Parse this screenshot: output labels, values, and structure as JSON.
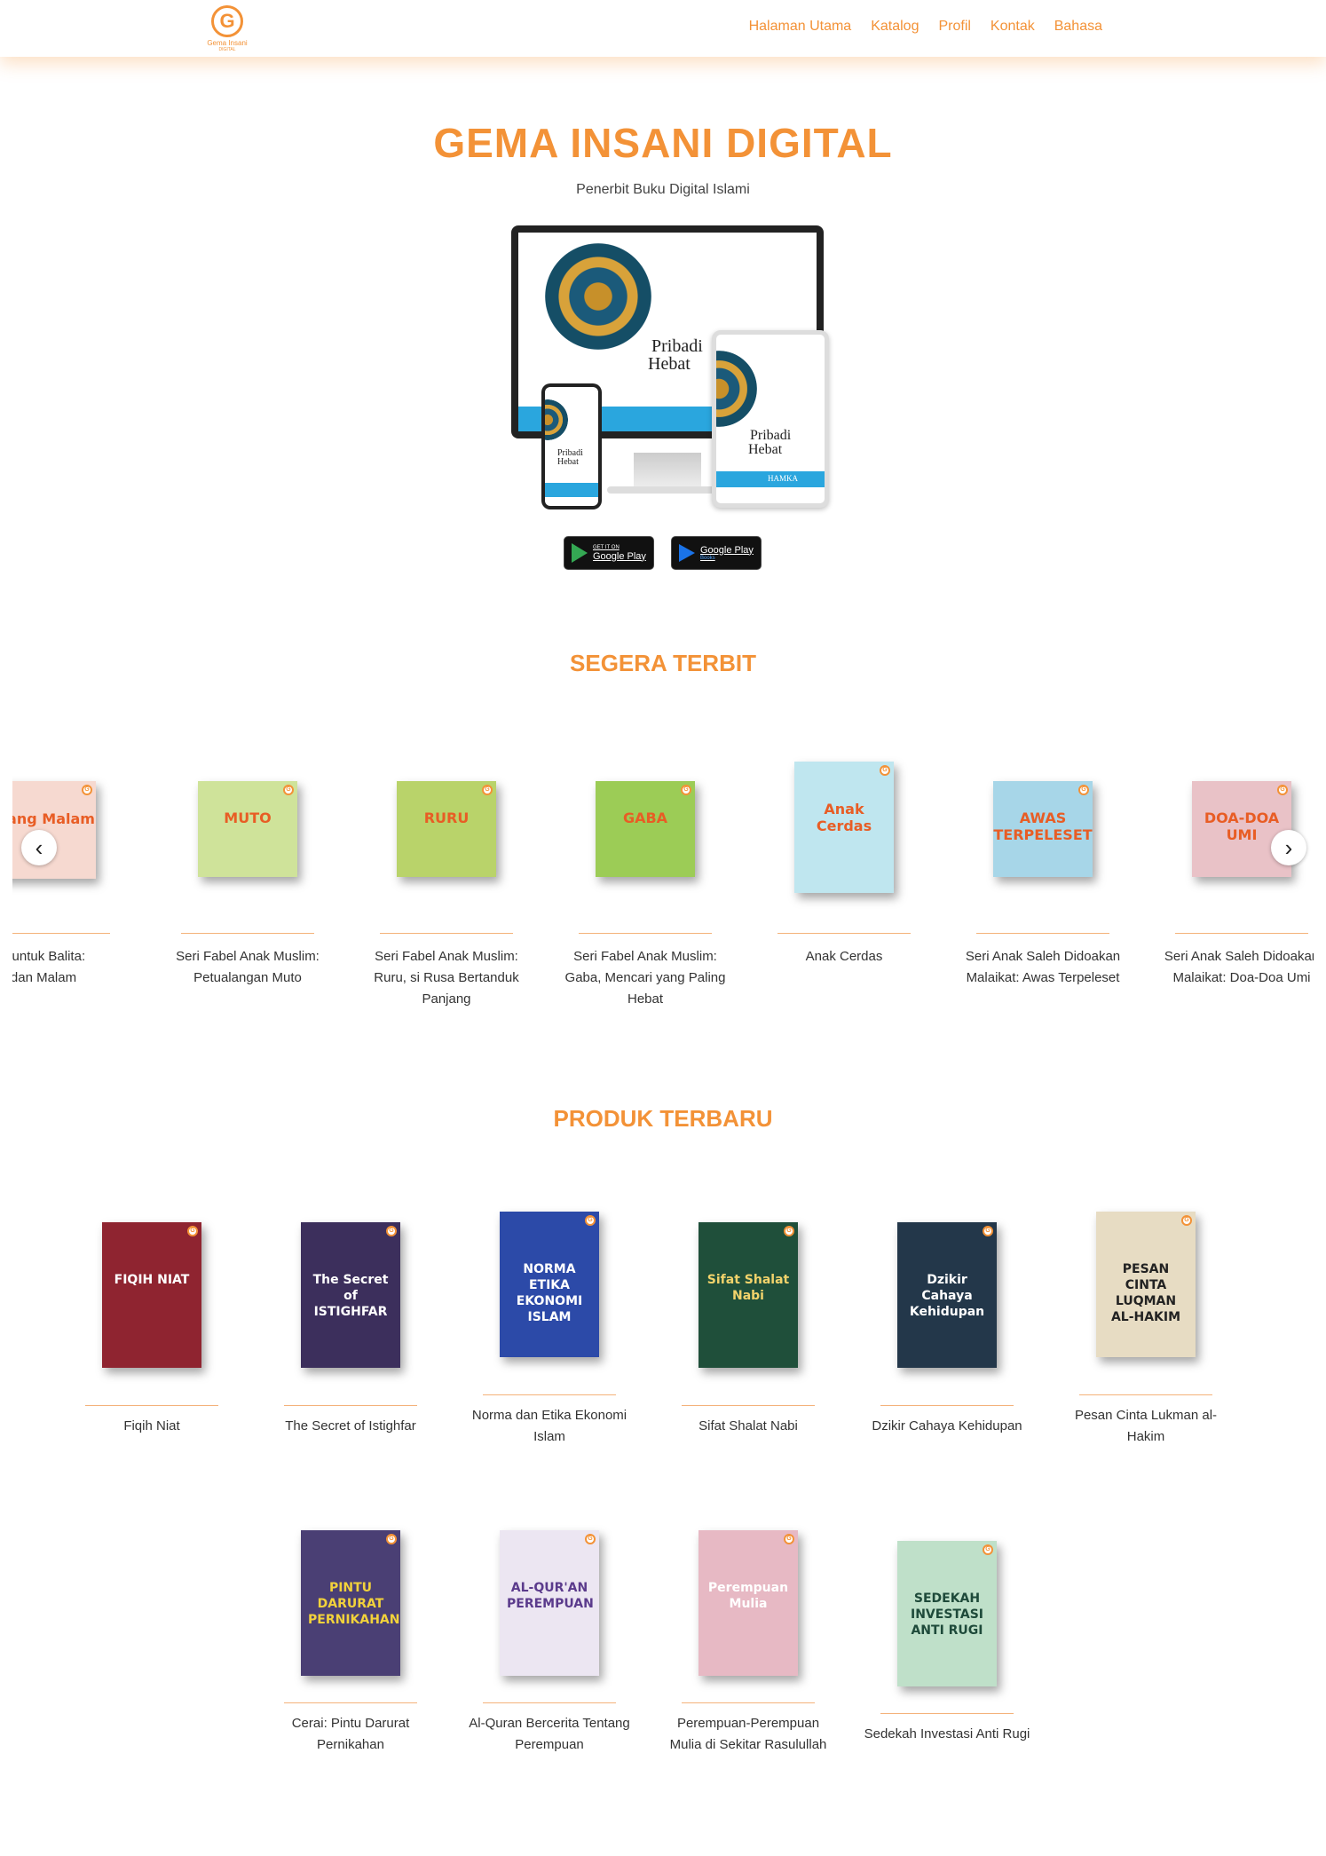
{
  "brand": {
    "logo_letter": "G",
    "logo_line1": "Gema Insani",
    "logo_line2": "DIGITAL"
  },
  "nav": [
    "Halaman Utama",
    "Katalog",
    "Profil",
    "Kontak",
    "Bahasa"
  ],
  "colors": {
    "accent": "#f39237",
    "text": "#333333"
  },
  "hero": {
    "title": "GEMA INSANI DIGITAL",
    "subtitle": "Penerbit Buku Digital Islami",
    "mockup_book_title_1": "Pribadi",
    "mockup_book_title_2": "Hebat",
    "mockup_author": "HAMKA",
    "store1_small": "GET IT ON",
    "store1_big": "Google Play",
    "store2_big": "Google Play",
    "store2_small": "Books"
  },
  "segera": {
    "title": "SEGERA TERBIT",
    "items": [
      {
        "caption": "s untuk Balita:\ndan Malam",
        "cover_text": "Siang Malam",
        "cover_color": "#f6d9d0"
      },
      {
        "caption": "Seri Fabel Anak Muslim:\nPetualangan Muto",
        "cover_text": "MUTO",
        "cover_color": "#cfe39a"
      },
      {
        "caption": "Seri Fabel Anak Muslim:\nRuru, si Rusa Bertanduk\nPanjang",
        "cover_text": "RURU",
        "cover_color": "#b9d36a"
      },
      {
        "caption": "Seri Fabel Anak Muslim:\nGaba, Mencari yang Paling\nHebat",
        "cover_text": "GABA",
        "cover_color": "#9ccc56"
      },
      {
        "caption": "Anak Cerdas",
        "cover_text": "Anak Cerdas",
        "cover_color": "#bfe6ef"
      },
      {
        "caption": "Seri Anak Saleh Didoakan\nMalaikat: Awas Terpeleset",
        "cover_text": "AWAS TERPELESET",
        "cover_color": "#a7d6e8"
      },
      {
        "caption": "Seri Anak Saleh Didoakan\nMalaikat: Doa-Doa Umi",
        "cover_text": "DOA-DOA UMI",
        "cover_color": "#e9c2c7"
      }
    ],
    "prev_arrow": "‹",
    "next_arrow": "›"
  },
  "produk": {
    "title": "PRODUK TERBARU",
    "items": [
      {
        "caption": "Fiqih Niat",
        "cover_text": "FIQIH NIAT",
        "cover_color": "#8f2430",
        "text_color": "#ffffff"
      },
      {
        "caption": "The Secret of Istighfar",
        "cover_text": "The Secret of ISTIGHFAR",
        "cover_color": "#3c2f5c",
        "text_color": "#ffffff"
      },
      {
        "caption": "Norma dan Etika Ekonomi\nIslam",
        "cover_text": "NORMA ETIKA EKONOMI ISLAM",
        "cover_color": "#2c4aa8",
        "text_color": "#ffffff"
      },
      {
        "caption": "Sifat Shalat Nabi",
        "cover_text": "Sifat Shalat Nabi",
        "cover_color": "#1f4f3a",
        "text_color": "#f2d36b"
      },
      {
        "caption": "Dzikir Cahaya Kehidupan",
        "cover_text": "Dzikir Cahaya Kehidupan",
        "cover_color": "#23374a",
        "text_color": "#ffffff"
      },
      {
        "caption": "Pesan Cinta Lukman al-\nHakim",
        "cover_text": "PESAN CINTA LUQMAN AL-HAKIM",
        "cover_color": "#e7dcc3",
        "text_color": "#222222"
      },
      {
        "caption": "Cerai: Pintu Darurat\nPernikahan",
        "cover_text": "PINTU DARURAT PERNIKAHAN",
        "cover_color": "#4a3f74",
        "text_color": "#f2d23b"
      },
      {
        "caption": "Al-Quran Bercerita Tentang\nPerempuan",
        "cover_text": "AL-QUR'AN PEREMPUAN",
        "cover_color": "#ece6f2",
        "text_color": "#5b3b8c"
      },
      {
        "caption": "Perempuan-Perempuan\nMulia di Sekitar Rasulullah",
        "cover_text": "Perempuan Mulia",
        "cover_color": "#e7b9c4",
        "text_color": "#ffffff"
      },
      {
        "caption": "Sedekah Investasi Anti Rugi",
        "cover_text": "SEDEKAH INVESTASI ANTI RUGI",
        "cover_color": "#bfe0c9",
        "text_color": "#1e4a3a"
      }
    ]
  }
}
